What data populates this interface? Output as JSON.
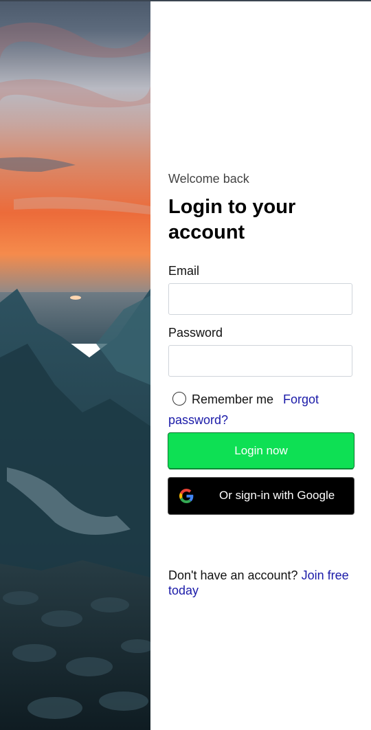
{
  "form": {
    "welcome": "Welcome back",
    "title": "Login to your account",
    "email_label": "Email",
    "email_value": "",
    "password_label": "Password",
    "password_value": "",
    "remember_label": "Remember me",
    "forgot_link": "Forgot password?",
    "login_button": "Login now",
    "google_button": "Or sign-in with Google",
    "signup_text": "Don't have an account?",
    "signup_link": "Join free today"
  },
  "icons": {
    "google": "google-g-icon",
    "remember": "radio-unchecked"
  },
  "colors": {
    "login_button": "#0ee054",
    "google_button": "#000000",
    "link": "#1a1aa8"
  }
}
